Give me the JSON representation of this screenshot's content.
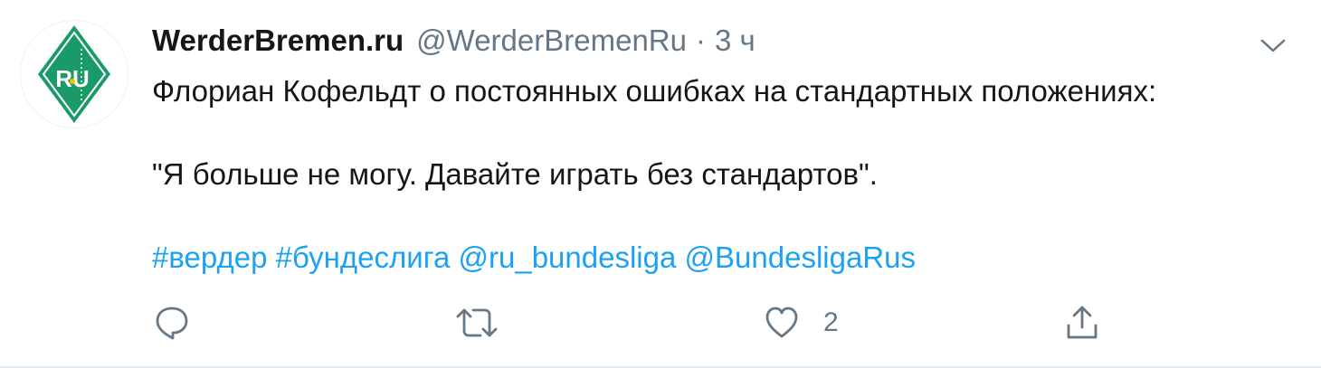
{
  "tweet": {
    "display_name": "WerderBremen.ru",
    "handle": "@WerderBremenRu",
    "separator": "·",
    "time": "3 ч",
    "text_line1": "Флориан Кофельдт о постоянных ошибках на стандартных положениях:",
    "text_line2": "\"Я больше не могу. Давайте играть без стандартов\".",
    "tags": [
      "#вердер",
      "#бундеслига",
      "@ru_bundesliga",
      "@BundesligaRus"
    ],
    "avatar_text": "RU",
    "like_count": "2"
  },
  "icons": {
    "caret": "chevron-down-icon",
    "reply": "reply-icon",
    "retweet": "retweet-icon",
    "like": "heart-icon",
    "share": "share-icon"
  },
  "colors": {
    "link": "#1da1f2",
    "muted": "#657786",
    "avatar_green": "#1a9a67"
  }
}
